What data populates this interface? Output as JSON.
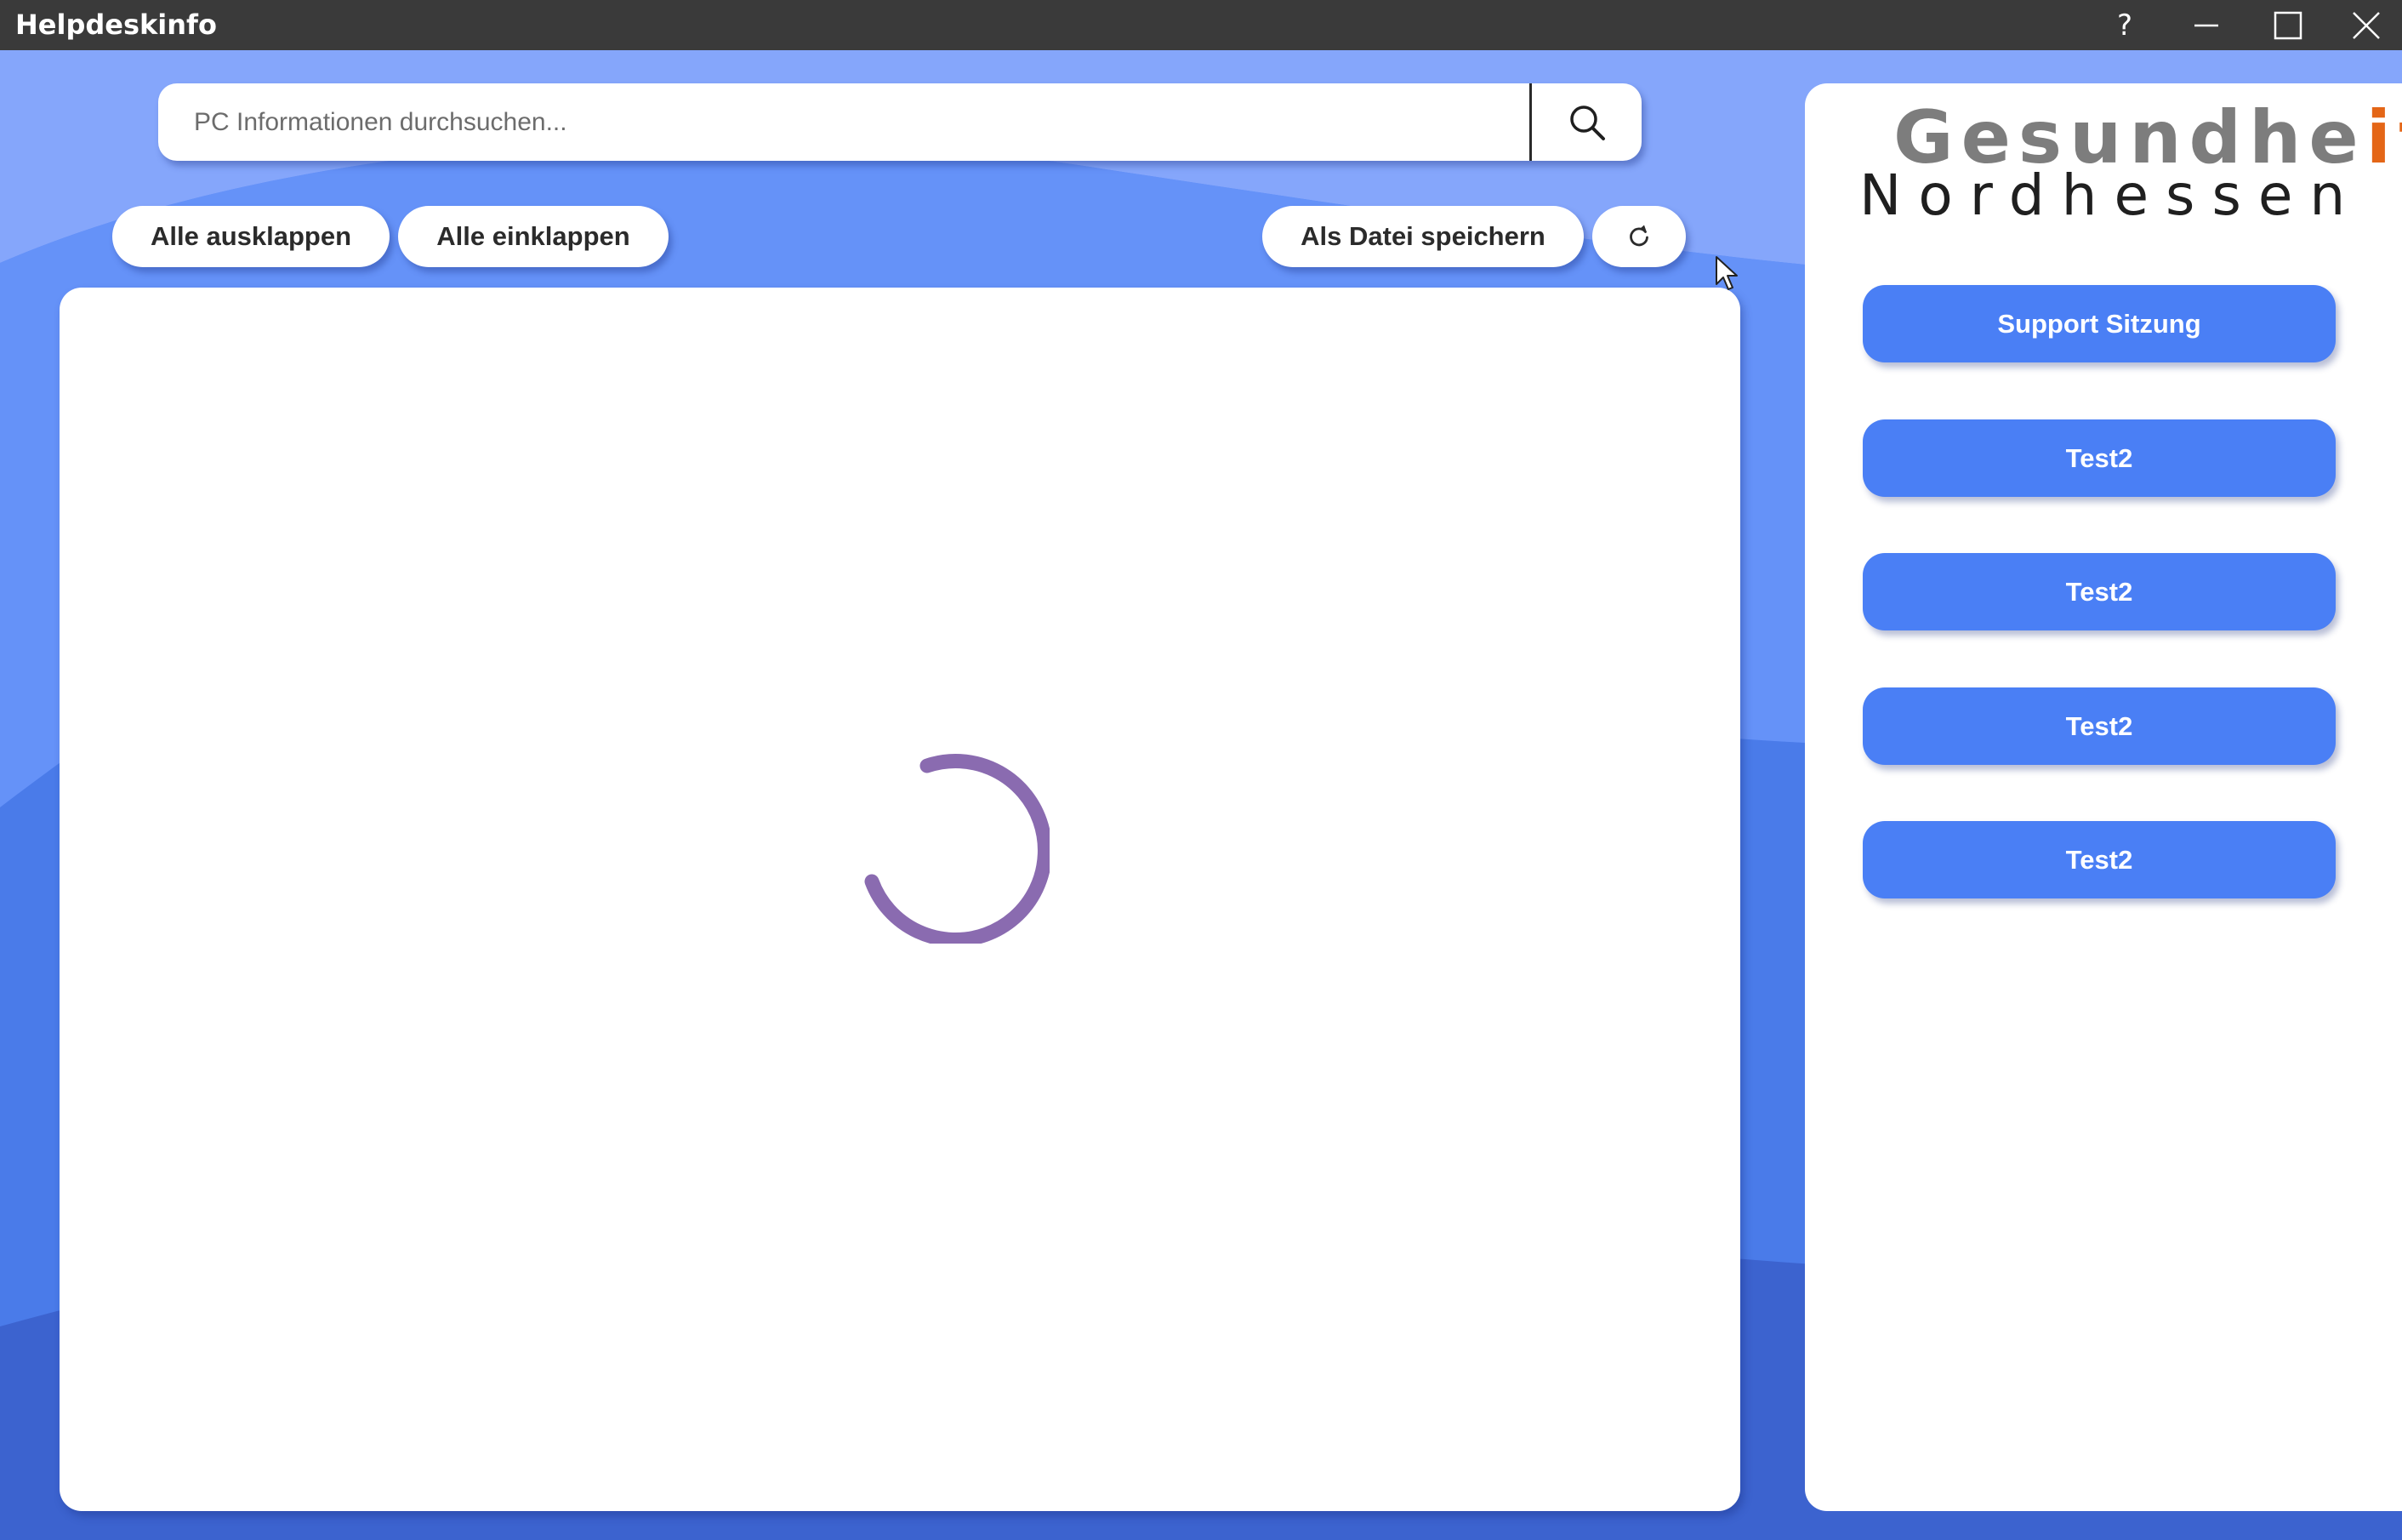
{
  "window": {
    "title": "Helpdeskinfo",
    "help_label": "?"
  },
  "search": {
    "placeholder": "PC Informationen durchsuchen..."
  },
  "toolbar": {
    "expand_all": "Alle ausklappen",
    "collapse_all": "Alle einklappen",
    "save_as_file": "Als Datei speichern"
  },
  "logo": {
    "line1_main": "Gesundhe",
    "line1_accent": "it",
    "line2": "Nordhessen"
  },
  "sidebar": {
    "buttons": [
      {
        "label": "Support Sitzung"
      },
      {
        "label": "Test2"
      },
      {
        "label": "Test2"
      },
      {
        "label": "Test2"
      },
      {
        "label": "Test2"
      }
    ]
  },
  "colors": {
    "titlebar": "#3a3a3a",
    "accent_blue": "#4a7ff5",
    "logo_grey": "#7d7d7d",
    "logo_orange": "#e46617",
    "spinner": "#8a6bb0"
  },
  "icons": {
    "search": "search-icon",
    "refresh": "refresh-icon",
    "minimize": "minimize-icon",
    "maximize": "maximize-icon",
    "close": "close-icon",
    "spinner": "loading-spinner-icon"
  }
}
